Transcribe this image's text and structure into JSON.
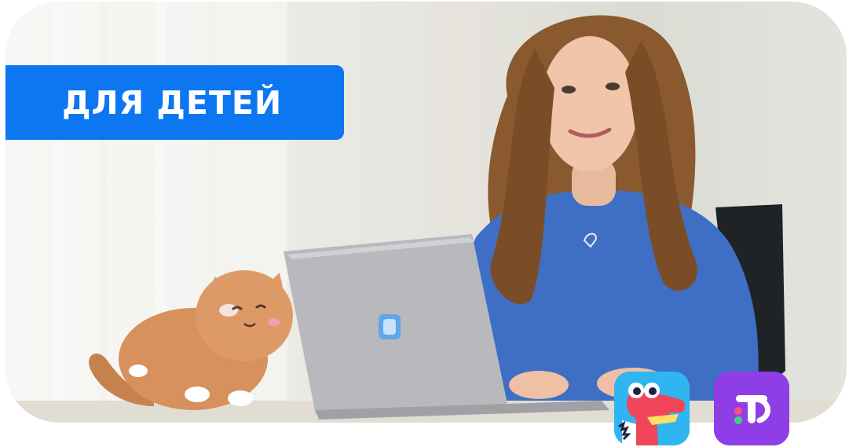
{
  "badge": {
    "label": "ДЛЯ ДЕТЕЙ"
  },
  "colors": {
    "badge_background": "#0D77F2",
    "badge_text": "#FFFFFF",
    "dino_app_background": "#2FB6F1",
    "tutor_app_background": "#8F3DE6"
  },
  "photo": {
    "subject": "girl-with-laptop-and-plush-cat"
  },
  "apps": [
    {
      "icon": "dino-app-icon"
    },
    {
      "icon": "tutor-app-icon"
    }
  ]
}
